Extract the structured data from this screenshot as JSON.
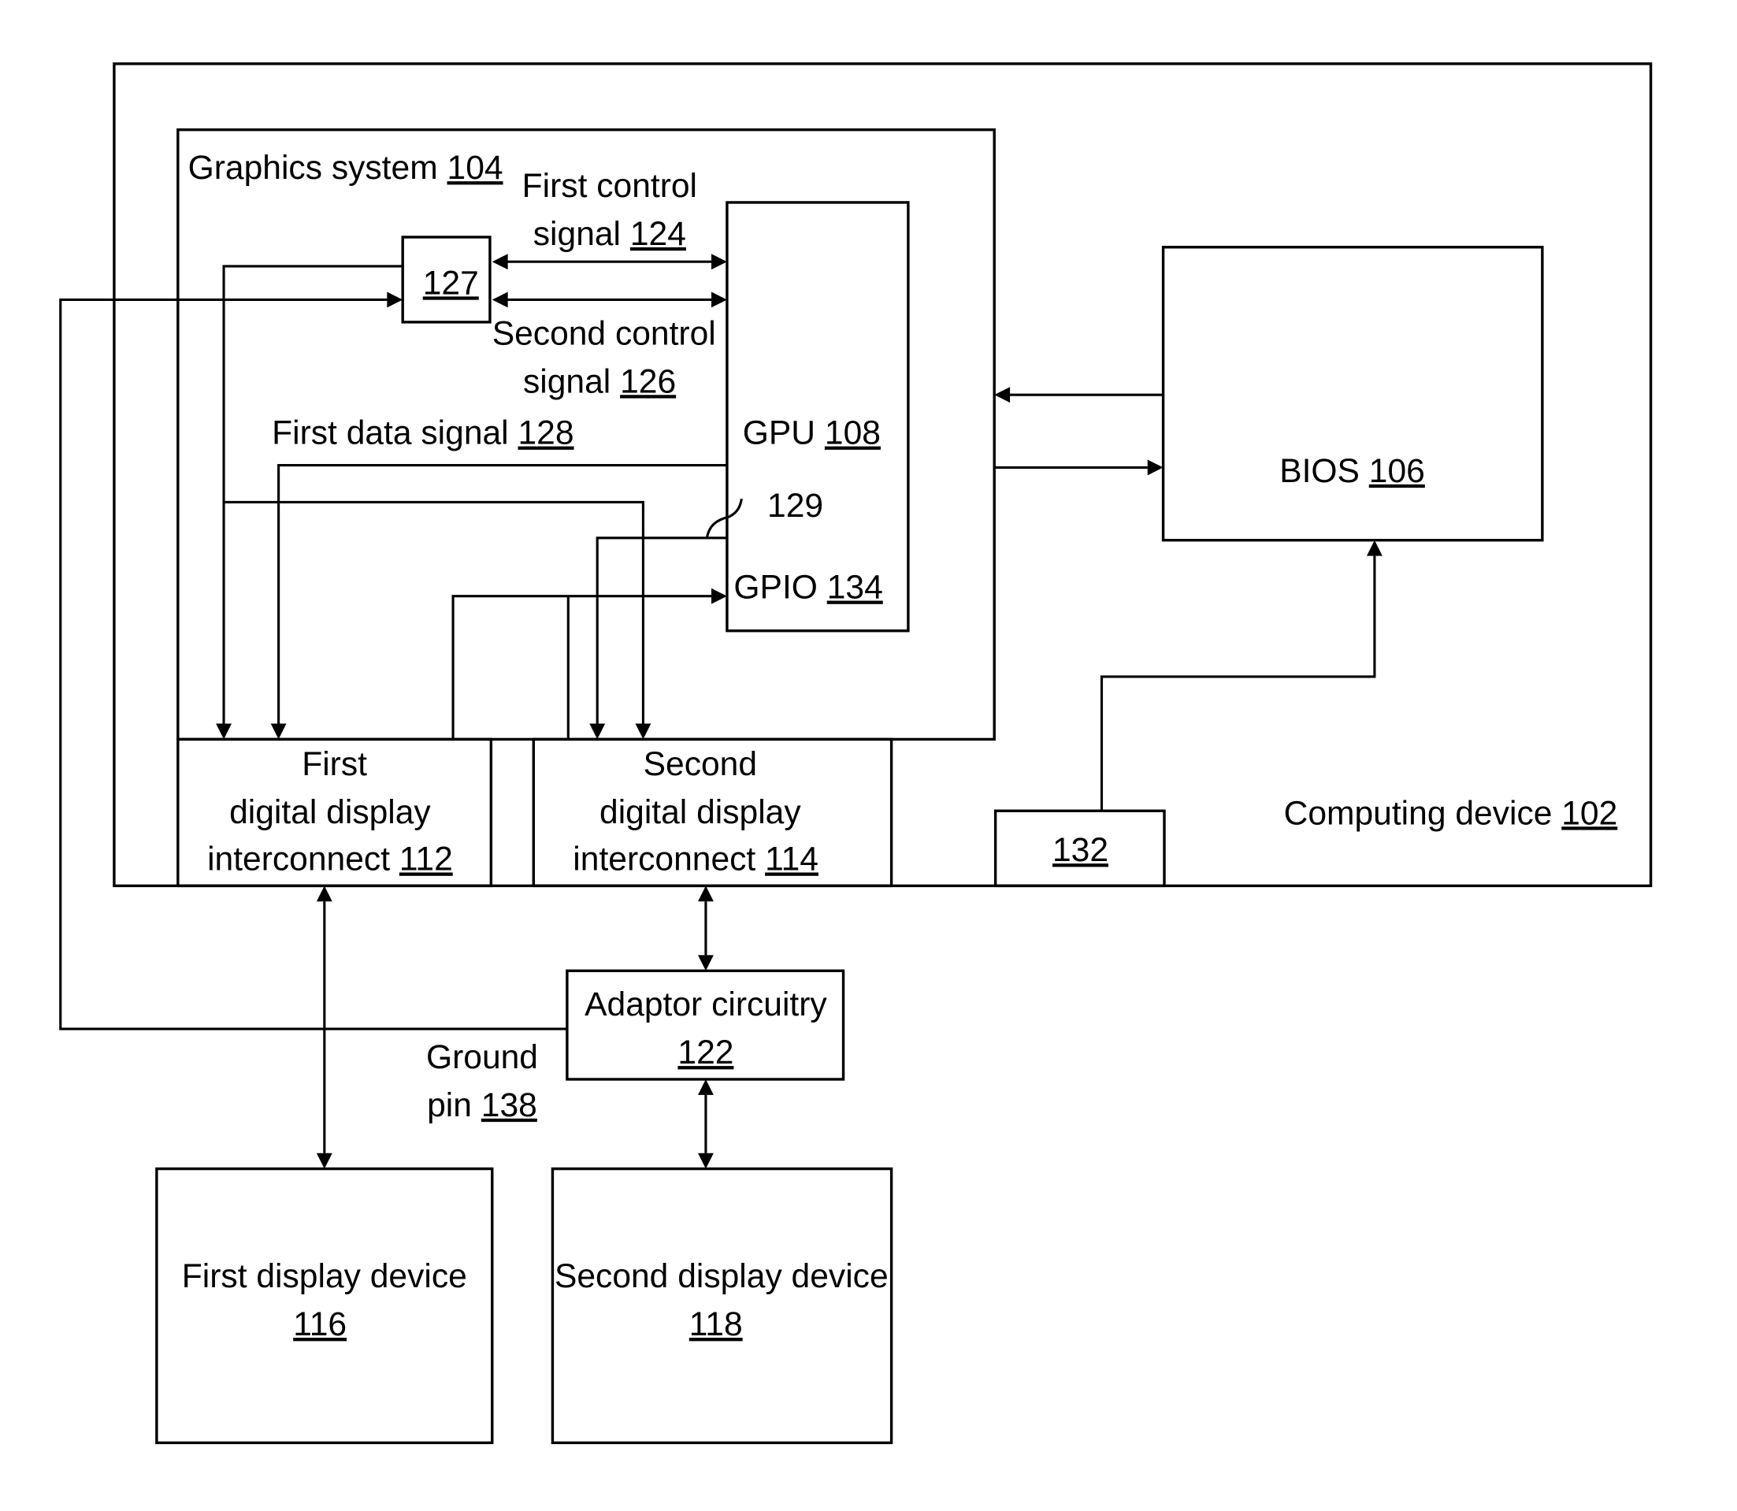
{
  "figure": {
    "computing_device": {
      "label": "Computing device",
      "ref": "102"
    },
    "graphics_system": {
      "label": "Graphics system",
      "ref": "104"
    },
    "bios": {
      "label": "BIOS",
      "ref": "106"
    },
    "gpu": {
      "label": "GPU",
      "ref": "108"
    },
    "gpio": {
      "label": "GPIO",
      "ref": "134"
    },
    "component_127": {
      "ref": "127"
    },
    "component_132": {
      "ref": "132"
    },
    "ref_129": "129",
    "first_control_signal": {
      "line1": "First control",
      "line2": "signal",
      "ref": "124"
    },
    "second_control_signal": {
      "line1": "Second control",
      "line2": "signal",
      "ref": "126"
    },
    "first_data_signal": {
      "label": "First data signal",
      "ref": "128"
    },
    "first_interconnect": {
      "line1": "First",
      "line2": "digital display",
      "line3": "interconnect",
      "ref": "112"
    },
    "second_interconnect": {
      "line1": "Second",
      "line2": "digital display",
      "line3": "interconnect",
      "ref": "114"
    },
    "adaptor": {
      "label": "Adaptor circuitry",
      "ref": "122"
    },
    "ground_pin": {
      "line1": "Ground",
      "line2": "pin",
      "ref": "138"
    },
    "first_display": {
      "label": "First display device",
      "ref": "116"
    },
    "second_display": {
      "label": "Second display device",
      "ref": "118"
    }
  }
}
